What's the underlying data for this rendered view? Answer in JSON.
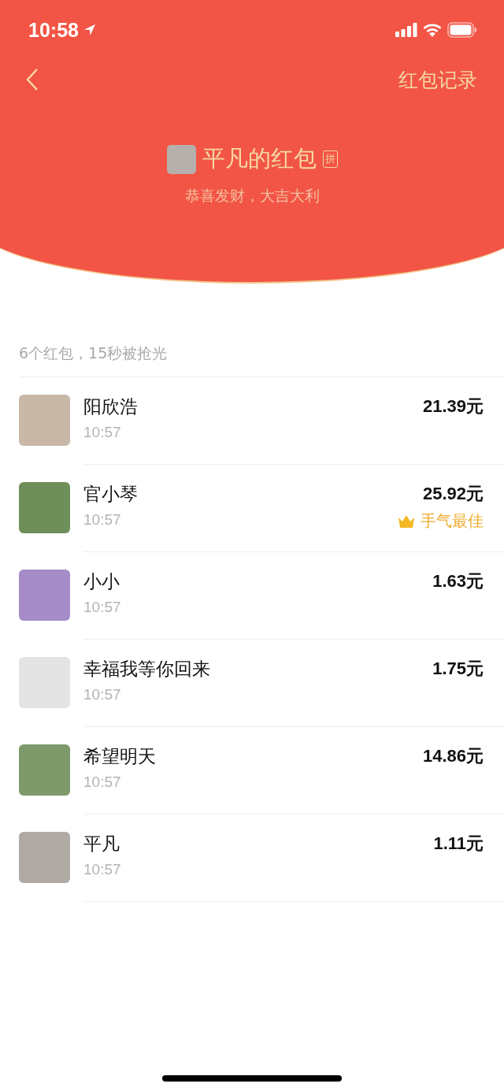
{
  "status_bar": {
    "time": "10:58"
  },
  "nav": {
    "right_link": "红包记录"
  },
  "envelope": {
    "title": "平凡的红包",
    "tag": "拼",
    "wish": "恭喜发财，大吉大利"
  },
  "summary": "6个红包，15秒被抢光",
  "rows": [
    {
      "name": "阳欣浩",
      "time": "10:57",
      "amount": "21.39元"
    },
    {
      "name": "官小琴",
      "time": "10:57",
      "amount": "25.92元",
      "badge": "手气最佳"
    },
    {
      "name": "小小",
      "time": "10:57",
      "amount": "1.63元"
    },
    {
      "name": "幸福我等你回来",
      "time": "10:57",
      "amount": "1.75元"
    },
    {
      "name": "希望明天",
      "time": "10:57",
      "amount": "14.86元"
    },
    {
      "name": "平凡",
      "time": "10:57",
      "amount": "1.11元"
    }
  ]
}
